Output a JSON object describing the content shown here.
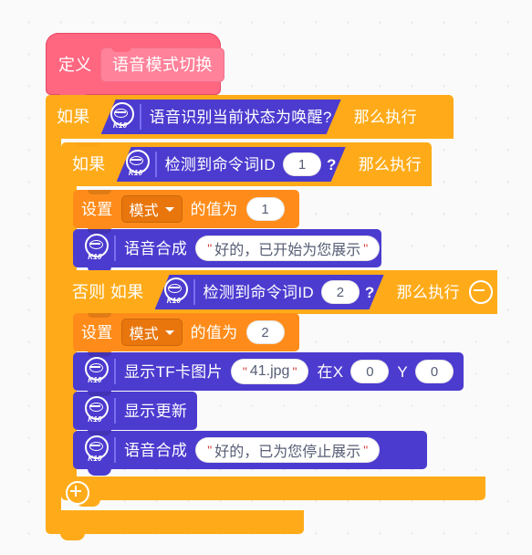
{
  "workspace": {
    "background_color": "#fafafa",
    "grid_dot_color": "#e6e6e6"
  },
  "palette": {
    "control_orange": "#ffab19",
    "variable_orange": "#ff8c1a",
    "extension_purple": "#4c3bcf",
    "define_pink": "#ff6680",
    "dropdown_orange": "#e8760d"
  },
  "script": {
    "define": {
      "keyword": "定义",
      "procedure_name": "语音模式切换"
    },
    "if_outer": {
      "keyword": "如果",
      "then_label": "那么执行",
      "condition": {
        "device": "K10",
        "text": "语音识别当前状态为唤醒?"
      }
    },
    "if_inner": {
      "keyword": "如果",
      "then_label": "那么执行",
      "condition": {
        "device": "K10",
        "text": "检测到命令词ID",
        "value": "1",
        "question_mark": "?"
      }
    },
    "set_mode_1": {
      "keyword": "设置",
      "variable": "模式",
      "middle": "的值为",
      "value": "1"
    },
    "speak_start": {
      "device": "K10",
      "text": "语音合成",
      "value": "好的，已开始为您展示",
      "quote": "\""
    },
    "else_if": {
      "keyword": "否则 如果",
      "then_label": "那么执行",
      "collapse_icon": "minus-circle-icon",
      "condition": {
        "device": "K10",
        "text": "检测到命令词ID",
        "value": "2",
        "question_mark": "?"
      }
    },
    "set_mode_2": {
      "keyword": "设置",
      "variable": "模式",
      "middle": "的值为",
      "value": "2"
    },
    "show_tf_image": {
      "device": "K10",
      "text": "显示TF卡图片",
      "filename": "41.jpg",
      "quote": "\"",
      "x_label": "在X",
      "x_value": "0",
      "y_label": "Y",
      "y_value": "0"
    },
    "display_update": {
      "device": "K10",
      "text": "显示更新"
    },
    "speak_stop": {
      "device": "K10",
      "text": "语音合成",
      "value": "好的，已为您停止展示",
      "quote": "\""
    },
    "add_branch": {
      "icon": "plus-circle-icon"
    }
  }
}
